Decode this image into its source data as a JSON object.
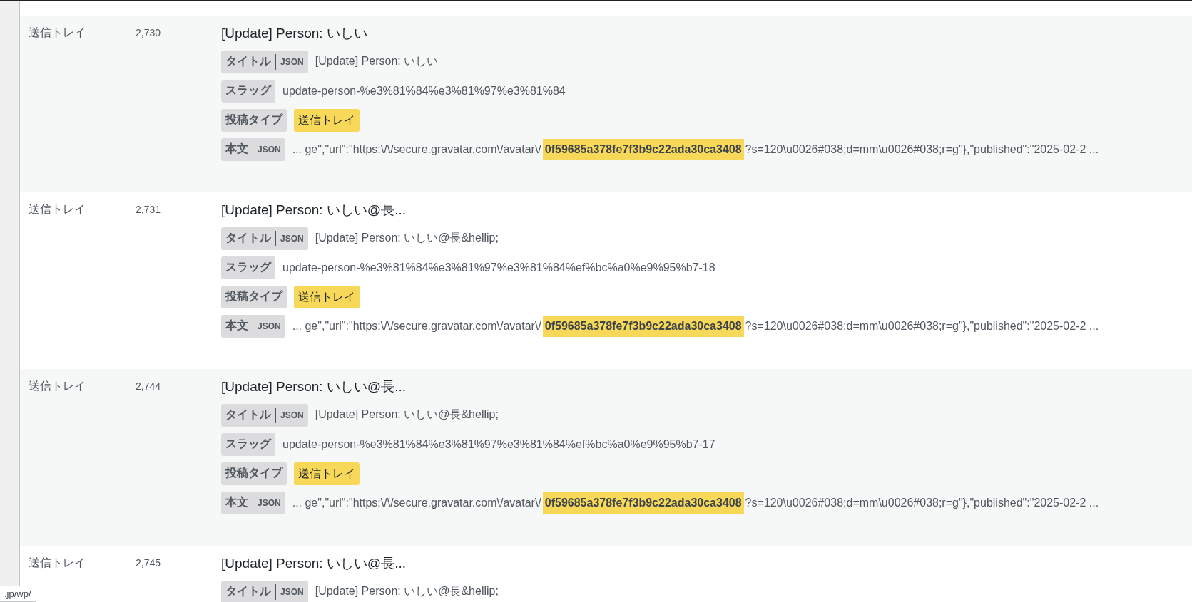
{
  "rows": [
    {
      "status": "送信トレイ",
      "id": "2,730",
      "title": "[Update] Person: いしい",
      "fields": [
        {
          "kind": "title",
          "label": "タイトル",
          "json_label": "JSON",
          "value": "[Update] Person: いしい"
        },
        {
          "kind": "slug",
          "label": "スラッグ",
          "value": "update-person-%e3%81%84%e3%81%97%e3%81%84"
        },
        {
          "kind": "type",
          "label": "投稿タイプ",
          "value": "送信トレイ"
        },
        {
          "kind": "body",
          "label": "本文",
          "json_label": "JSON",
          "before": "... ge\",\"url\":\"https:\\/\\/secure.gravatar.com\\/avatar\\/",
          "highlight": "0f59685a378fe7f3b9c22ada30ca3408",
          "after": "?s=120\\u0026#038;d=mm\\u0026#038;r=g\"},\"published\":\"2025-02-2 ..."
        }
      ]
    },
    {
      "status": "送信トレイ",
      "id": "2,731",
      "title": "[Update] Person: いしい@長...",
      "fields": [
        {
          "kind": "title",
          "label": "タイトル",
          "json_label": "JSON",
          "value": "[Update] Person: いしい@長&hellip;"
        },
        {
          "kind": "slug",
          "label": "スラッグ",
          "value": "update-person-%e3%81%84%e3%81%97%e3%81%84%ef%bc%a0%e9%95%b7-18"
        },
        {
          "kind": "type",
          "label": "投稿タイプ",
          "value": "送信トレイ"
        },
        {
          "kind": "body",
          "label": "本文",
          "json_label": "JSON",
          "before": "... ge\",\"url\":\"https:\\/\\/secure.gravatar.com\\/avatar\\/",
          "highlight": "0f59685a378fe7f3b9c22ada30ca3408",
          "after": "?s=120\\u0026#038;d=mm\\u0026#038;r=g\"},\"published\":\"2025-02-2 ..."
        }
      ]
    },
    {
      "status": "送信トレイ",
      "id": "2,744",
      "title": "[Update] Person: いしい@長...",
      "fields": [
        {
          "kind": "title",
          "label": "タイトル",
          "json_label": "JSON",
          "value": "[Update] Person: いしい@長&hellip;"
        },
        {
          "kind": "slug",
          "label": "スラッグ",
          "value": "update-person-%e3%81%84%e3%81%97%e3%81%84%ef%bc%a0%e9%95%b7-17"
        },
        {
          "kind": "type",
          "label": "投稿タイプ",
          "value": "送信トレイ"
        },
        {
          "kind": "body",
          "label": "本文",
          "json_label": "JSON",
          "before": "... ge\",\"url\":\"https:\\/\\/secure.gravatar.com\\/avatar\\/",
          "highlight": "0f59685a378fe7f3b9c22ada30ca3408",
          "after": "?s=120\\u0026#038;d=mm\\u0026#038;r=g\"},\"published\":\"2025-02-2 ..."
        }
      ]
    },
    {
      "status": "送信トレイ",
      "id": "2,745",
      "title": "[Update] Person: いしい@長...",
      "fields": [
        {
          "kind": "title",
          "label": "タイトル",
          "json_label": "JSON",
          "value": "[Update] Person: いしい@長&hellip;"
        }
      ]
    }
  ],
  "status_url": ".jp/wp/"
}
